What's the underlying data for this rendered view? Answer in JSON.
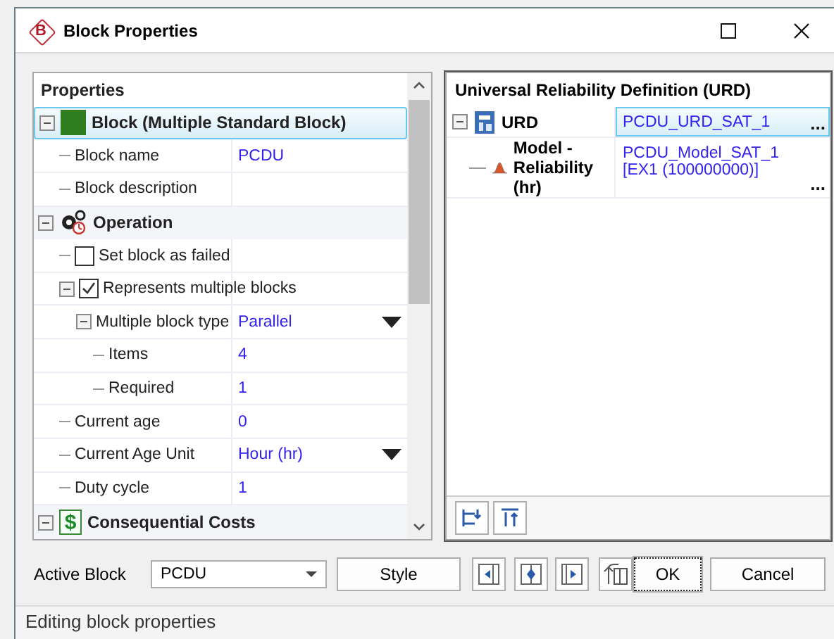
{
  "window": {
    "title": "Block Properties",
    "logo_letter": "B"
  },
  "properties": {
    "title": "Properties",
    "groups": [
      {
        "kind": "block",
        "label": "Block (Multiple Standard Block)",
        "selected": true,
        "expanded": true,
        "rows": [
          {
            "kind": "text",
            "label": "Block name",
            "value": "PCDU"
          },
          {
            "kind": "text",
            "label": "Block description"
          }
        ]
      },
      {
        "kind": "operation",
        "label": "Operation",
        "selected": false,
        "expanded": true,
        "rows": [
          {
            "kind": "checkbox",
            "label": "Set block as failed",
            "checked": false
          },
          {
            "kind": "checkbox",
            "label": "Represents multiple blocks",
            "checked": true,
            "expanded": true,
            "children": [
              {
                "kind": "dropdown",
                "label": "Multiple block type",
                "value": "Parallel",
                "expanded": true,
                "children": [
                  {
                    "kind": "text",
                    "label": "Items",
                    "value": "4"
                  },
                  {
                    "kind": "text",
                    "label": "Required",
                    "value": "1"
                  }
                ]
              }
            ]
          },
          {
            "kind": "text",
            "label": "Current age",
            "value": "0"
          },
          {
            "kind": "dropdown",
            "label": "Current Age Unit",
            "value": "Hour (hr)"
          },
          {
            "kind": "text",
            "label": "Duty cycle",
            "value": "1"
          }
        ]
      },
      {
        "kind": "costs",
        "label": "Consequential Costs",
        "icon_text": "$",
        "selected": false,
        "expanded": true
      }
    ]
  },
  "urd": {
    "title": "Universal Reliability Definition (URD)",
    "rows": [
      {
        "kind": "urd",
        "label": "URD",
        "value": "PCDU_URD_SAT_1",
        "action": "...",
        "selected": true,
        "expanded": true,
        "children": [
          {
            "kind": "model",
            "label": "Model - Reliability (hr)",
            "value": "PCDU_Model_SAT_1 [EX1 (100000000)]",
            "action": "...",
            "selected": false
          }
        ]
      }
    ]
  },
  "footer": {
    "active_block_label": "Active Block",
    "active_block": "PCDU",
    "buttons": [
      {
        "kind": "text",
        "label": "Style",
        "focused": false
      },
      {
        "kind": "align-left"
      },
      {
        "kind": "align-center"
      },
      {
        "kind": "align-right"
      },
      {
        "kind": "rotate"
      },
      {
        "kind": "text",
        "label": "OK",
        "focused": true
      },
      {
        "kind": "text",
        "label": "Cancel",
        "focused": false
      }
    ]
  },
  "status_bar": "Editing block properties"
}
